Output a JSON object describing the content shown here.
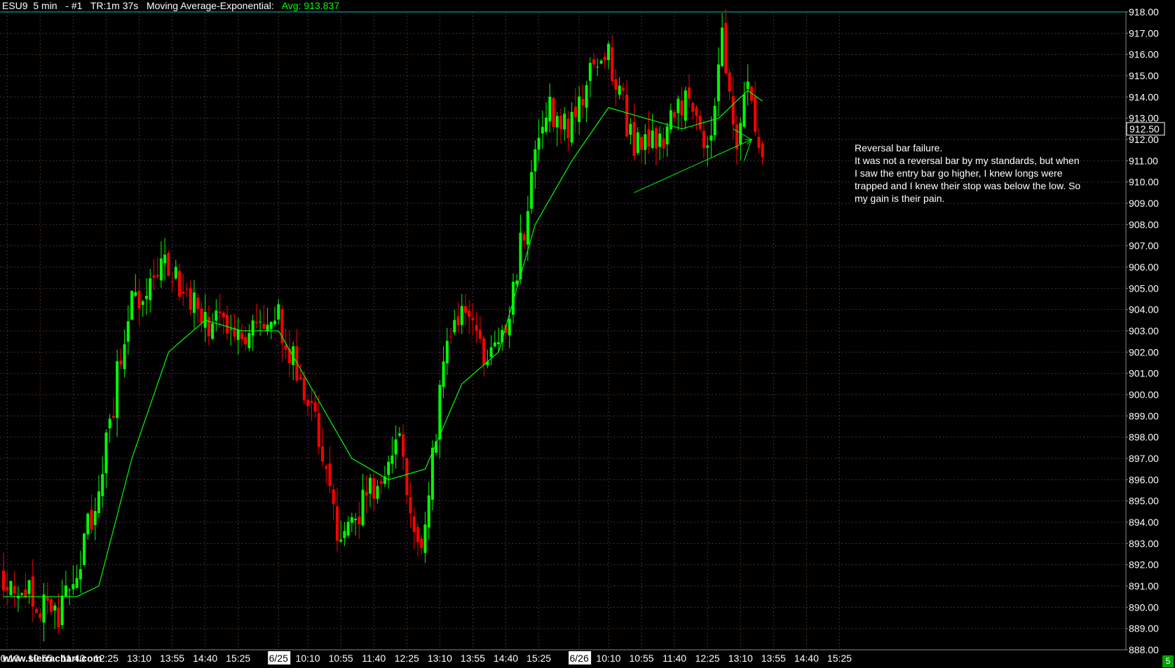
{
  "header": {
    "symbol": "ESU9",
    "interval": "5 min",
    "chart_number": "- #1",
    "timer": "TR:1m 37s",
    "study_name": "Moving Average-Exponential:",
    "avg_text": "Avg: 913.837"
  },
  "current_price_label": "912.50",
  "annotation": [
    "Reversal bar failure.",
    "It was not a reversal bar by my standards, but when",
    "I saw the entry bar go higher, I knew longs were",
    "trapped and I knew their stop was below the low. So",
    "my gain is their pain."
  ],
  "logo_text": "www.sierrachart.com",
  "corner_badge": "5",
  "colors": {
    "background": "#000000",
    "up_bar": "#00ff00",
    "down_bar": "#ff0000",
    "moving_average": "#00ff00",
    "grid": "#4a2a4a",
    "text": "#ffffff"
  },
  "chart_data": {
    "type": "candlestick",
    "title": "",
    "xlabel": "",
    "ylabel": "",
    "ylim": [
      888,
      918
    ],
    "y_ticks": [
      "918.00",
      "917.00",
      "916.00",
      "915.00",
      "914.00",
      "913.00",
      "912.00",
      "911.00",
      "910.00",
      "909.00",
      "908.00",
      "907.00",
      "906.00",
      "905.00",
      "904.00",
      "903.00",
      "902.00",
      "901.00",
      "900.00",
      "899.00",
      "898.00",
      "897.00",
      "896.00",
      "895.00",
      "894.00",
      "893.00",
      "892.00",
      "891.00",
      "890.00",
      "889.00",
      "888.00"
    ],
    "x_ticks": [
      {
        "label": "10:10",
        "bar": 1
      },
      {
        "label": "10:55",
        "bar": 10
      },
      {
        "label": "11:40",
        "bar": 19
      },
      {
        "label": "12:25",
        "bar": 28
      },
      {
        "label": "13:10",
        "bar": 37
      },
      {
        "label": "13:55",
        "bar": 46
      },
      {
        "label": "14:40",
        "bar": 55
      },
      {
        "label": "15:25",
        "bar": 64
      },
      {
        "label": "6/25",
        "bar": 75,
        "highlight": true
      },
      {
        "label": "10:10",
        "bar": 83
      },
      {
        "label": "10:55",
        "bar": 92
      },
      {
        "label": "11:40",
        "bar": 101
      },
      {
        "label": "12:25",
        "bar": 110
      },
      {
        "label": "13:10",
        "bar": 119
      },
      {
        "label": "13:55",
        "bar": 128
      },
      {
        "label": "14:40",
        "bar": 137
      },
      {
        "label": "15:25",
        "bar": 146
      },
      {
        "label": "6/26",
        "bar": 157,
        "highlight": true
      },
      {
        "label": "10:10",
        "bar": 165
      },
      {
        "label": "10:55",
        "bar": 174
      },
      {
        "label": "11:40",
        "bar": 183
      },
      {
        "label": "12:25",
        "bar": 192
      },
      {
        "label": "13:10",
        "bar": 201
      },
      {
        "label": "13:55",
        "bar": 210
      },
      {
        "label": "14:40",
        "bar": 219
      },
      {
        "label": "15:25",
        "bar": 228
      }
    ],
    "x_tick_labels": [
      "10:10",
      "10:55",
      "11:40",
      "12:25",
      "13:10",
      "13:55",
      "14:40",
      "15:25",
      "6/25",
      "10:10",
      "10:55",
      "11:40",
      "12:25",
      "13:10",
      "13:55",
      "14:40",
      "15:25",
      "6/26",
      "10:10",
      "10:55",
      "11:40",
      "12:25",
      "13:10",
      "13:55",
      "14:40",
      "15:25"
    ],
    "key_points": [
      {
        "bar": 0,
        "price": 891.5
      },
      {
        "bar": 15,
        "price": 889.5
      },
      {
        "bar": 22,
        "price": 893.0
      },
      {
        "bar": 27,
        "price": 896.5
      },
      {
        "bar": 34,
        "price": 904.0
      },
      {
        "bar": 45,
        "price": 906.0
      },
      {
        "bar": 55,
        "price": 903.5
      },
      {
        "bar": 65,
        "price": 902.5
      },
      {
        "bar": 75,
        "price": 903.5
      },
      {
        "bar": 85,
        "price": 898.5
      },
      {
        "bar": 92,
        "price": 893.0
      },
      {
        "bar": 100,
        "price": 895.5
      },
      {
        "bar": 108,
        "price": 897.5
      },
      {
        "bar": 114,
        "price": 892.5
      },
      {
        "bar": 120,
        "price": 901.5
      },
      {
        "bar": 125,
        "price": 904.5
      },
      {
        "bar": 130,
        "price": 902.0
      },
      {
        "bar": 137,
        "price": 903.0
      },
      {
        "bar": 143,
        "price": 909.0
      },
      {
        "bar": 148,
        "price": 913.5
      },
      {
        "bar": 155,
        "price": 912.5
      },
      {
        "bar": 163,
        "price": 916.5
      },
      {
        "bar": 167,
        "price": 915.0
      },
      {
        "bar": 172,
        "price": 911.5
      },
      {
        "bar": 180,
        "price": 912.0
      },
      {
        "bar": 187,
        "price": 914.5
      },
      {
        "bar": 192,
        "price": 911.0
      },
      {
        "bar": 196,
        "price": 916.5
      },
      {
        "bar": 200,
        "price": 912.0
      },
      {
        "bar": 203,
        "price": 915.5
      },
      {
        "bar": 207,
        "price": 910.5
      }
    ],
    "moving_average_points": [
      {
        "bar": 0,
        "price": 890.5
      },
      {
        "bar": 20,
        "price": 890.5
      },
      {
        "bar": 26,
        "price": 891.0
      },
      {
        "bar": 35,
        "price": 897.0
      },
      {
        "bar": 45,
        "price": 902.0
      },
      {
        "bar": 55,
        "price": 903.5
      },
      {
        "bar": 65,
        "price": 903.0
      },
      {
        "bar": 75,
        "price": 903.0
      },
      {
        "bar": 85,
        "price": 900.0
      },
      {
        "bar": 95,
        "price": 897.0
      },
      {
        "bar": 105,
        "price": 896.0
      },
      {
        "bar": 115,
        "price": 896.5
      },
      {
        "bar": 125,
        "price": 900.5
      },
      {
        "bar": 135,
        "price": 902.0
      },
      {
        "bar": 145,
        "price": 908.0
      },
      {
        "bar": 155,
        "price": 911.0
      },
      {
        "bar": 165,
        "price": 913.5
      },
      {
        "bar": 175,
        "price": 913.0
      },
      {
        "bar": 185,
        "price": 912.5
      },
      {
        "bar": 195,
        "price": 913.0
      },
      {
        "bar": 203,
        "price": 914.3
      },
      {
        "bar": 207,
        "price": 913.8
      }
    ],
    "trendlines": [
      {
        "from": {
          "bar": 172,
          "price": 909.5
        },
        "to": {
          "bar": 204,
          "price": 912.0
        },
        "arrow": true
      },
      {
        "from": {
          "bar": 199,
          "price": 912.5
        },
        "to": {
          "bar": 204,
          "price": 912.0
        },
        "arrow": false
      },
      {
        "from": {
          "bar": 202,
          "price": 911.0
        },
        "to": {
          "bar": 204,
          "price": 912.0
        },
        "arrow": false
      }
    ],
    "current_price": 912.5
  }
}
